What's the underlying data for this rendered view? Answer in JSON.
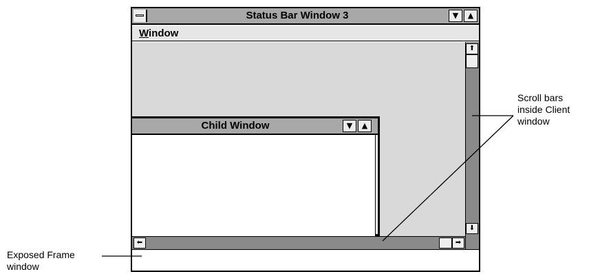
{
  "window": {
    "title": "Status Bar Window 3",
    "menu": {
      "window_label_prefix": "W",
      "window_label_rest": "indow"
    },
    "buttons": {
      "minimize_glyph": "▼",
      "maximize_glyph": "▲"
    }
  },
  "child_window": {
    "title": "Child Window",
    "buttons": {
      "minimize_glyph": "▼",
      "maximize_glyph": "▲"
    }
  },
  "scrollbars": {
    "up_glyph": "⬆",
    "down_glyph": "⬇",
    "left_glyph": "⬅",
    "right_glyph": "➡"
  },
  "annotations": {
    "scroll_bars": [
      "Scroll bars",
      "inside Client",
      "window"
    ],
    "exposed_frame": [
      "Exposed Frame",
      "window"
    ]
  }
}
